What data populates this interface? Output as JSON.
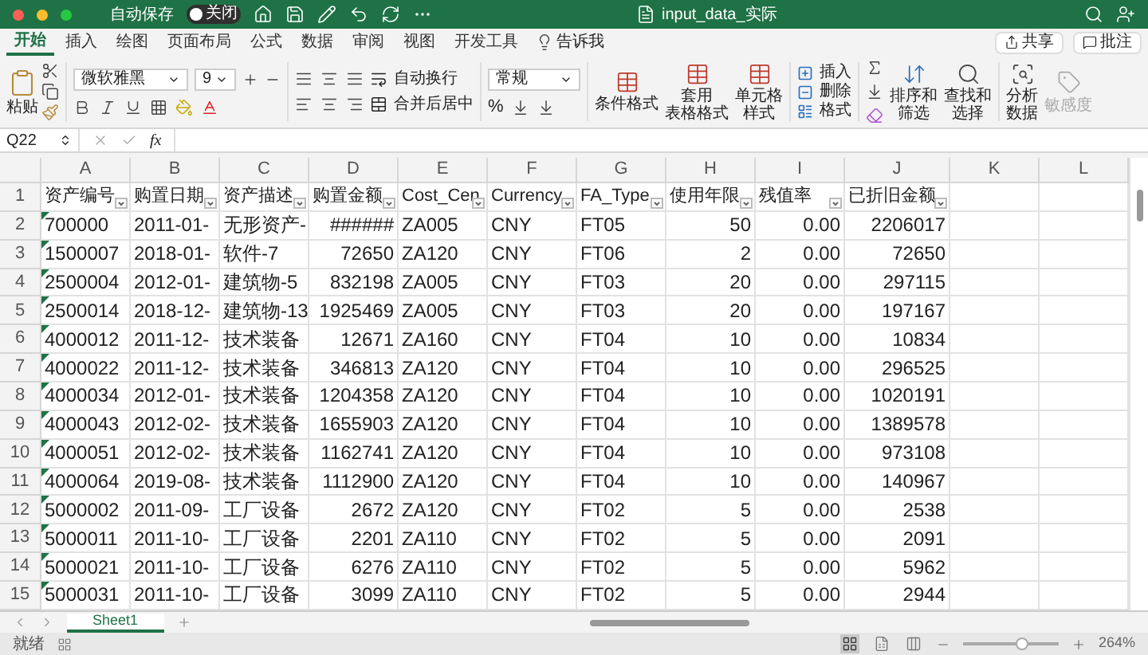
{
  "title_bar": {
    "autosave_label": "自动保存",
    "autosave_toggle": {
      "label": "关闭",
      "on": false
    },
    "title": "input_data_实际"
  },
  "ribbon_tabs": [
    {
      "label": "开始",
      "selected": true
    },
    {
      "label": "插入",
      "selected": false
    },
    {
      "label": "绘图",
      "selected": false
    },
    {
      "label": "页面布局",
      "selected": false
    },
    {
      "label": "公式",
      "selected": false
    },
    {
      "label": "数据",
      "selected": false
    },
    {
      "label": "审阅",
      "selected": false
    },
    {
      "label": "视图",
      "selected": false
    },
    {
      "label": "开发工具",
      "selected": false
    }
  ],
  "tell_me": "告诉我",
  "share_button": "共享",
  "comments_button": "批注",
  "ribbon": {
    "paste": "粘贴",
    "font_name": "微软雅黑",
    "font_size": "9",
    "wrap_text": "自动换行",
    "merge_center": "合并后居中",
    "number_format": "常规",
    "percent": "%",
    "styles": [
      {
        "lines": [
          "条件格式"
        ]
      },
      {
        "lines": [
          "套用",
          "表格格式"
        ]
      },
      {
        "lines": [
          "单元格",
          "样式"
        ]
      }
    ],
    "cells": [
      "插入",
      "删除",
      "格式"
    ],
    "editing": [
      {
        "lines": [
          "排序和",
          "筛选"
        ]
      },
      {
        "lines": [
          "查找和",
          "选择"
        ]
      }
    ],
    "analyze": {
      "lines": [
        "分析",
        "数据"
      ]
    },
    "sensitivity": {
      "label": "敏感度",
      "disabled": true
    }
  },
  "formula_bar": {
    "name_box": "Q22",
    "fx": "fx"
  },
  "sheet": {
    "columns": [
      "A",
      "B",
      "C",
      "D",
      "E",
      "F",
      "G",
      "H",
      "I",
      "J",
      "K",
      "L"
    ],
    "rows": [
      {
        "number": "1",
        "kind": "header",
        "cells": [
          "资产编号",
          "购置日期",
          "资产描述",
          "购置金额",
          "Cost_Cen",
          "Currency",
          "FA_Type",
          "使用年限",
          "残值率",
          "已折旧金额"
        ]
      },
      {
        "number": "2",
        "kind": "data",
        "cells": [
          "700000",
          "2011-01-",
          "无形资产-",
          "######",
          "ZA005",
          "CNY",
          "FT05",
          "50",
          "0.00",
          "2206017"
        ]
      },
      {
        "number": "3",
        "kind": "data",
        "cells": [
          "1500007",
          "2018-01-",
          "软件-7",
          "72650",
          "ZA120",
          "CNY",
          "FT06",
          "2",
          "0.00",
          "72650"
        ]
      },
      {
        "number": "4",
        "kind": "data",
        "cells": [
          "2500004",
          "2012-01-",
          "建筑物-5",
          "832198",
          "ZA005",
          "CNY",
          "FT03",
          "20",
          "0.00",
          "297115"
        ]
      },
      {
        "number": "5",
        "kind": "data",
        "cells": [
          "2500014",
          "2018-12-",
          "建筑物-13",
          "1925469",
          "ZA005",
          "CNY",
          "FT03",
          "20",
          "0.00",
          "197167"
        ]
      },
      {
        "number": "6",
        "kind": "data",
        "cells": [
          "4000012",
          "2011-12-",
          "技术装备",
          "12671",
          "ZA160",
          "CNY",
          "FT04",
          "10",
          "0.00",
          "10834"
        ]
      },
      {
        "number": "7",
        "kind": "data",
        "cells": [
          "4000022",
          "2011-12-",
          "技术装备",
          "346813",
          "ZA120",
          "CNY",
          "FT04",
          "10",
          "0.00",
          "296525"
        ]
      },
      {
        "number": "8",
        "kind": "data",
        "cells": [
          "4000034",
          "2012-01-",
          "技术装备",
          "1204358",
          "ZA120",
          "CNY",
          "FT04",
          "10",
          "0.00",
          "1020191"
        ]
      },
      {
        "number": "9",
        "kind": "data",
        "cells": [
          "4000043",
          "2012-02-",
          "技术装备",
          "1655903",
          "ZA120",
          "CNY",
          "FT04",
          "10",
          "0.00",
          "1389578"
        ]
      },
      {
        "number": "10",
        "kind": "data",
        "cells": [
          "4000051",
          "2012-02-",
          "技术装备",
          "1162741",
          "ZA120",
          "CNY",
          "FT04",
          "10",
          "0.00",
          "973108"
        ]
      },
      {
        "number": "11",
        "kind": "data",
        "cells": [
          "4000064",
          "2019-08-",
          "技术装备",
          "1112900",
          "ZA120",
          "CNY",
          "FT04",
          "10",
          "0.00",
          "140967"
        ]
      },
      {
        "number": "12",
        "kind": "data",
        "cells": [
          "5000002",
          "2011-09-",
          "工厂设备",
          "2672",
          "ZA120",
          "CNY",
          "FT02",
          "5",
          "0.00",
          "2538"
        ]
      },
      {
        "number": "13",
        "kind": "data",
        "cells": [
          "5000011",
          "2011-10-",
          "工厂设备",
          "2201",
          "ZA110",
          "CNY",
          "FT02",
          "5",
          "0.00",
          "2091"
        ]
      },
      {
        "number": "14",
        "kind": "data",
        "cells": [
          "5000021",
          "2011-10-",
          "工厂设备",
          "6276",
          "ZA110",
          "CNY",
          "FT02",
          "5",
          "0.00",
          "5962"
        ]
      },
      {
        "number": "15",
        "kind": "data",
        "cells": [
          "5000031",
          "2011-10-",
          "工厂设备",
          "3099",
          "ZA110",
          "CNY",
          "FT02",
          "5",
          "0.00",
          "2944"
        ]
      }
    ]
  },
  "sheet_tabs": [
    {
      "label": "Sheet1",
      "selected": true
    }
  ],
  "status": "就绪",
  "views": [
    {
      "selected": true
    },
    {
      "selected": false
    },
    {
      "selected": false
    }
  ],
  "zoom": {
    "level": 0.62,
    "reading": "264%"
  }
}
